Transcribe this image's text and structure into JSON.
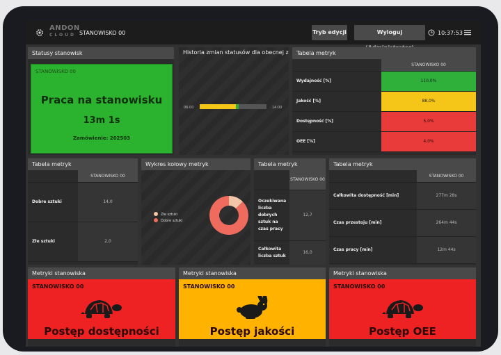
{
  "topbar": {
    "logo_top": "ANDON",
    "logo_bottom": "CLOUD",
    "workstation": "STANOWISKO 00",
    "edit_mode": "Tryb edycji",
    "logout": "Wyloguj",
    "logout_role": "(Administrator)",
    "time": "10:37:53"
  },
  "status_panel": {
    "title": "Statusy stanowisk",
    "workstation": "STANOWISKO 00",
    "status": "Praca na stanowisku",
    "duration": "13m 1s",
    "order": "Zamówienie: 202503",
    "color": "#2bb32f"
  },
  "history_panel": {
    "title": "Historia zmian statusów dla obecnej zmiany",
    "start": "06:00",
    "end": "14:00",
    "bar_progress": 0.58,
    "segments": [
      {
        "color": "#f5c518",
        "share": 0.54
      },
      {
        "color": "#2fb03a",
        "share": 0.04
      }
    ]
  },
  "metrics_main": {
    "title": "Tabela metryk",
    "column": "STANOWISKO 00",
    "rows": [
      {
        "label": "Wydajność [%]",
        "value": "110,0%",
        "status": "green"
      },
      {
        "label": "Jakość [%]",
        "value": "88,0%",
        "status": "yellow"
      },
      {
        "label": "Dostępność [%]",
        "value": "5,0%",
        "status": "red"
      },
      {
        "label": "OEE [%]",
        "value": "4,0%",
        "status": "red"
      }
    ]
  },
  "metrics_parts": {
    "title": "Tabela metryk",
    "column": "STANOWISKO 00",
    "rows": [
      {
        "label": "Dobre sztuki",
        "value": "14,0"
      },
      {
        "label": "Złe sztuki",
        "value": "2,0"
      }
    ]
  },
  "pie_panel": {
    "title": "Wykres kołowy metryk",
    "legend": [
      {
        "label": "Złe sztuki",
        "color": "#f2c4a8"
      },
      {
        "label": "Dobre sztuki",
        "color": "#ee6b5e"
      }
    ],
    "chart_data": {
      "type": "pie",
      "categories": [
        "Złe sztuki",
        "Dobre sztuki"
      ],
      "values": [
        2,
        14
      ]
    }
  },
  "metrics_expected": {
    "title": "Tabela metryk",
    "column": "STANOWISKO 00",
    "rows": [
      {
        "label": "Oczekiwana liczba dobrych sztuk na czas pracy",
        "value": "12,7"
      },
      {
        "label": "Całkowita liczba sztuk",
        "value": "16,0"
      }
    ]
  },
  "metrics_time": {
    "title": "Tabela metryk",
    "column": "STANOWISKO 00",
    "rows": [
      {
        "label": "Całkowita dostępność [min]",
        "value": "277m 28s"
      },
      {
        "label": "Czas przestoju [min]",
        "value": "264m 44s"
      },
      {
        "label": "Czas pracy [min]",
        "value": "12m 44s"
      }
    ]
  },
  "bottom_cards": [
    {
      "title": "Metryki stanowiska",
      "workstation": "STANOWISKO 00",
      "label": "Postęp dostępności",
      "icon": "turtle-icon",
      "color": "#ee2222"
    },
    {
      "title": "Metryki stanowiska",
      "workstation": "STANOWISKO 00",
      "label": "Postęp jakości",
      "icon": "rabbit-icon",
      "color": "#ffb300"
    },
    {
      "title": "Metryki stanowiska",
      "workstation": "STANOWISKO 00",
      "label": "Postęp OEE",
      "icon": "turtle-icon",
      "color": "#ee2222"
    }
  ]
}
